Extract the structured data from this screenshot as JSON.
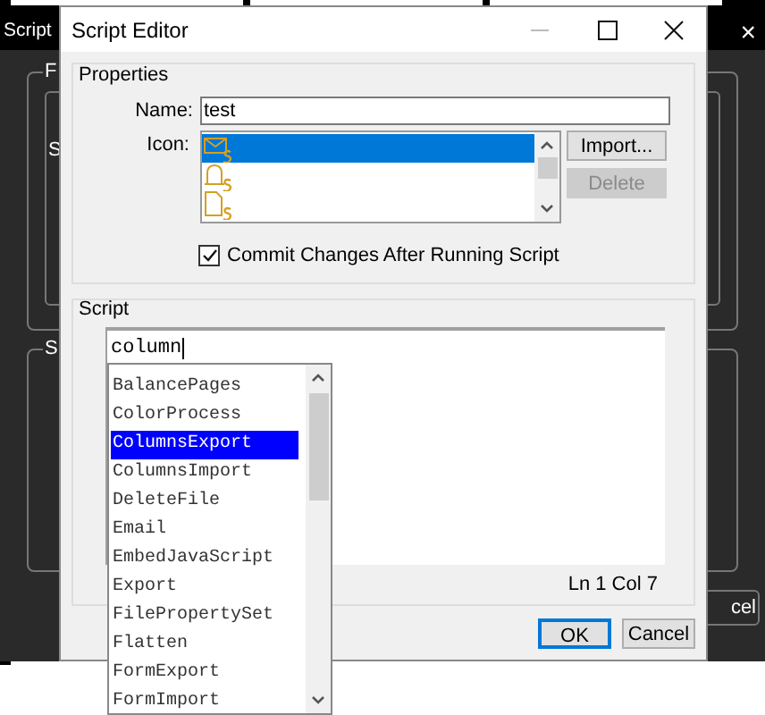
{
  "background_window": {
    "title": "Script",
    "close": "×",
    "group_labels": [
      "F",
      "S"
    ],
    "row_fragment": "S",
    "button_fragment": "cel"
  },
  "dialog": {
    "title": "Script Editor",
    "properties": {
      "title": "Properties",
      "name_label": "Name:",
      "name_value": "test",
      "icon_label": "Icon:",
      "icons": [
        {
          "kind": "envelope",
          "selected": true
        },
        {
          "kind": "bell",
          "selected": false
        },
        {
          "kind": "document",
          "selected": false
        }
      ],
      "buttons": [
        {
          "label": "Import...",
          "disabled": false
        },
        {
          "label": "Delete",
          "disabled": true
        }
      ],
      "commit": {
        "label": "Commit Changes After Running Script",
        "checked": true
      }
    },
    "script": {
      "title": "Script",
      "code": "column",
      "position": "Ln 1 Col 7",
      "autocomplete": [
        {
          "label": "BalancePages",
          "selected": false
        },
        {
          "label": "ColorProcess",
          "selected": false
        },
        {
          "label": "ColumnsExport",
          "selected": true
        },
        {
          "label": "ColumnsImport",
          "selected": false
        },
        {
          "label": "DeleteFile",
          "selected": false
        },
        {
          "label": "Email",
          "selected": false
        },
        {
          "label": "EmbedJavaScript",
          "selected": false
        },
        {
          "label": "Export",
          "selected": false
        },
        {
          "label": "FilePropertySet",
          "selected": false
        },
        {
          "label": "Flatten",
          "selected": false
        },
        {
          "label": "FormExport",
          "selected": false
        },
        {
          "label": "FormImport",
          "selected": false
        }
      ]
    },
    "buttons": [
      {
        "label": "OK",
        "default": true
      },
      {
        "label": "Cancel",
        "default": false
      }
    ]
  }
}
